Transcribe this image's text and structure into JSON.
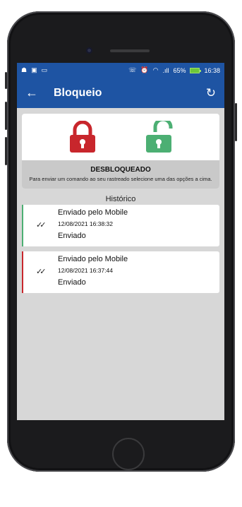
{
  "status_bar": {
    "battery": "65%",
    "time": "16:38",
    "signal_text": ".ıll"
  },
  "app_bar": {
    "title": "Bloqueio"
  },
  "lock_panel": {
    "lock_color": "#c8262c",
    "unlock_color": "#4caf73",
    "status_title": "DESBLOQUEADO",
    "status_desc": "Para enviar um comando ao seu rastreado selecione uma das opções a cima."
  },
  "history": {
    "title": "Histórico",
    "items": [
      {
        "title": "Enviado pelo Mobile",
        "date": "12/08/2021 16:38:32",
        "status": "Enviado",
        "color": "#4caf73"
      },
      {
        "title": "Enviado pelo Mobile",
        "date": "12/08/2021 16:37:44",
        "status": "Enviado",
        "color": "#c8262c"
      }
    ]
  }
}
